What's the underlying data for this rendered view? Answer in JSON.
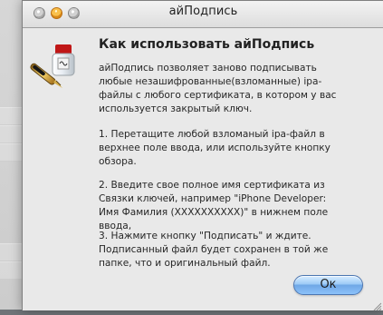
{
  "window": {
    "title": "айПодпись"
  },
  "dialog": {
    "heading": "Как использовать айПодпись",
    "intro": "айПодпись позволяет заново подписывать любые незашифрованные(взломанные) ipa-файлы с любого сертификата, в котором у вас используется закрытый ключ.",
    "step1": "1. Перетащите любой взломаный ipa-файл в верхнее поле ввода, или используйте кнопку обзора.",
    "step2": "2. Введите свое полное имя сертификата из Связки ключей, например \"iPhone Developer: Имя Фамилия (XXXXXXXXXX)\" в нижнем поле ввода,",
    "step3": "3. Нажмите кнопку \"Подписать\" и ждите. Подписанный файл будет сохранен в той же папке, что и оригинальный файл.",
    "ok_label": "Ок"
  },
  "icons": {
    "app": "ink-pen-icon",
    "close": "close-icon",
    "minimize": "minimize-icon",
    "zoom": "zoom-icon",
    "resize": "resize-grip-icon"
  }
}
